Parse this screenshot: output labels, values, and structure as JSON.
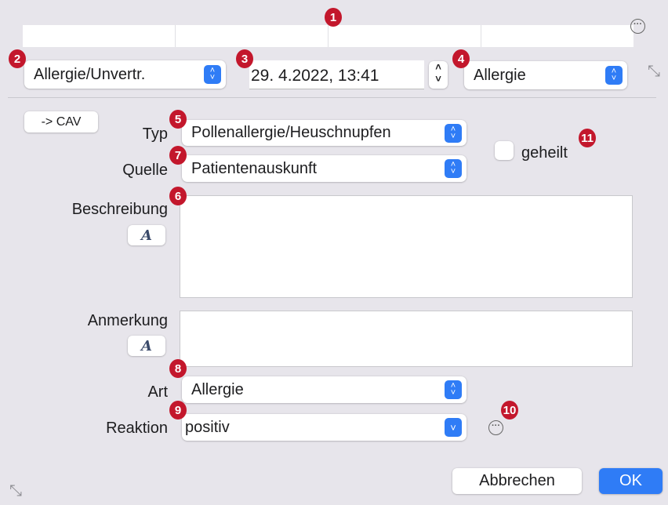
{
  "badges": {
    "b1": "1",
    "b2": "2",
    "b3": "3",
    "b4": "4",
    "b5": "5",
    "b6": "6",
    "b7": "7",
    "b8": "8",
    "b9": "9",
    "b10": "10",
    "b11": "11"
  },
  "header": {
    "category": "Allergie/Unvertr.",
    "datetime": "29.  4.2022, 13:41",
    "kind": "Allergie"
  },
  "form": {
    "cav_label": "-> CAV",
    "typ_label": "Typ",
    "typ_value": "Pollenallergie/Heuschnupfen",
    "quelle_label": "Quelle",
    "quelle_value": "Patientenauskunft",
    "geheilt_label": "geheilt",
    "geheilt_checked": false,
    "beschreibung_label": "Beschreibung",
    "beschreibung_value": "",
    "anmerkung_label": "Anmerkung",
    "anmerkung_value": "",
    "font_button": "A",
    "art_label": "Art",
    "art_value": "Allergie",
    "reaktion_label": "Reaktion",
    "reaktion_value": "positiv"
  },
  "footer": {
    "cancel": "Abbrechen",
    "ok": "OK"
  },
  "colors": {
    "accent": "#2f7cf6",
    "badge": "#c3172c"
  }
}
